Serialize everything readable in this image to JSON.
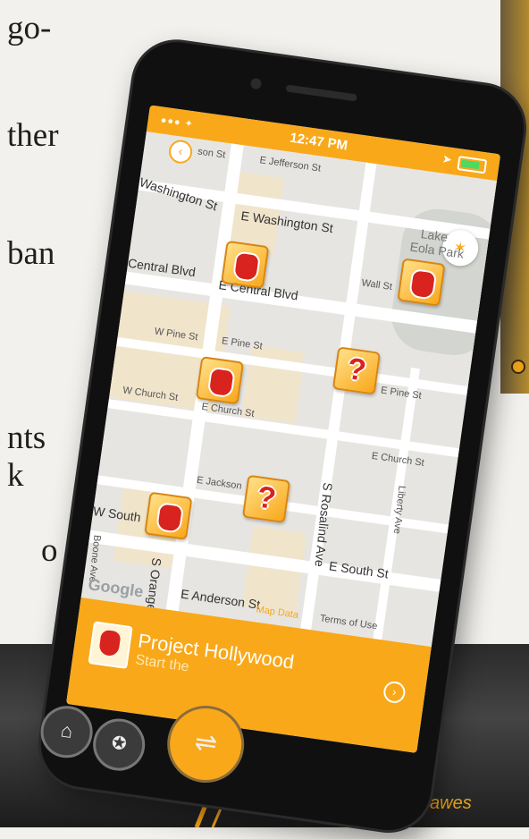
{
  "slide": {
    "text_fragments": [
      "go-",
      "ther",
      "ban",
      "nts",
      "k",
      "o"
    ]
  },
  "status_bar": {
    "time": "12:47 PM",
    "signal": "●●● ✦"
  },
  "map": {
    "streets": [
      "son St",
      "E Jefferson St",
      "Washington St",
      "E Washington St",
      "Lake",
      "Eola Park",
      "Wall St",
      "Central Blvd",
      "E Central Blvd",
      "W Pine St",
      "E Pine St",
      "E Pine St",
      "W Church St",
      "E Church St",
      "E Church St",
      "E Jackson",
      "S Rosalind Ave",
      "Liberty Ave",
      "W South",
      "E South St",
      "Boone Ave",
      "S Orange Ave",
      "E Anderson St"
    ],
    "attribution_google": "Google",
    "map_data": "Map Data",
    "terms": "Terms of Use"
  },
  "quest_panel": {
    "title": "Project Hollywood",
    "subtitle": "Start the"
  },
  "quote": "\"We had an awes",
  "colors": {
    "accent": "#f9a81a",
    "marker_red": "#d8231f"
  }
}
